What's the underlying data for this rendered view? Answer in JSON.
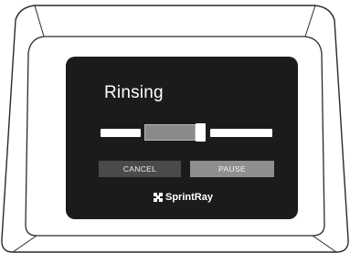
{
  "display": {
    "status_title": "Rinsing",
    "progress_fraction": 0.5
  },
  "buttons": {
    "cancel_label": "CANCEL",
    "pause_label": "PAUSE"
  },
  "brand": {
    "name": "SprintRay",
    "logo_icon": "sprintray-logo-icon"
  },
  "colors": {
    "screen_background": "#1b1b1b",
    "cancel_button": "#4a4a4a",
    "pause_button": "#8e8e8e"
  }
}
